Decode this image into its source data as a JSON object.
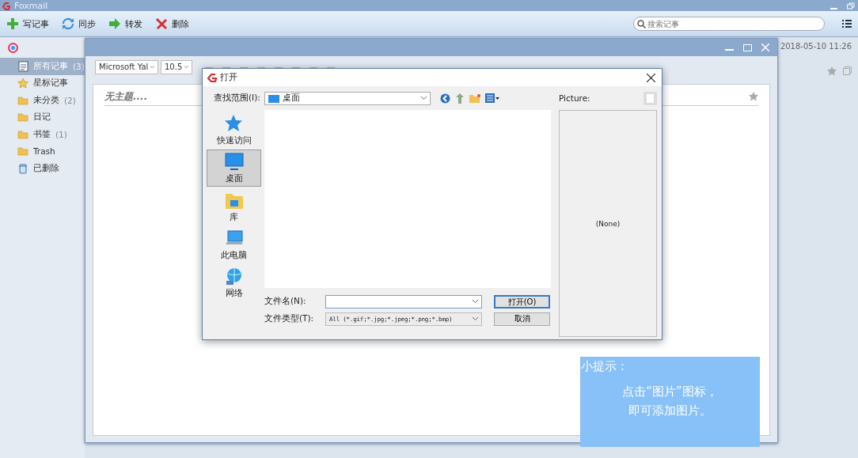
{
  "main_window": {
    "title": "Foxmail",
    "toolbar": [
      {
        "kind": "add",
        "label": "写记事"
      },
      {
        "kind": "sync",
        "label": "同步"
      },
      {
        "kind": "forward",
        "label": "转发"
      },
      {
        "kind": "delete",
        "label": "删除"
      }
    ],
    "search": {
      "placeholder": "搜索记事"
    },
    "sidebar": {
      "items": [
        {
          "kind": "notes",
          "label": "所有记事",
          "count": "(3)",
          "selected": true
        },
        {
          "kind": "star",
          "label": "星标记事",
          "selected": false
        },
        {
          "kind": "folder",
          "label": "未分类",
          "count": "(2)",
          "selected": false
        },
        {
          "kind": "folder",
          "label": "日记",
          "selected": false
        },
        {
          "kind": "folder",
          "label": "书签",
          "count": "(1)",
          "selected": false
        },
        {
          "kind": "folder",
          "label": "Trash",
          "selected": false
        },
        {
          "kind": "trash",
          "label": "已删除",
          "selected": false
        }
      ]
    },
    "timestamp": "2018-05-10 11:26"
  },
  "editor_window": {
    "font": "Microsoft Yal",
    "font_size": "10.5",
    "subject_placeholder": "无主题...."
  },
  "dialog": {
    "title": "打开",
    "look_in_label": "查找范围(I):",
    "look_in": "桌面",
    "places": [
      {
        "kind": "quick",
        "label": "快速访问",
        "selected": false
      },
      {
        "kind": "desktop",
        "label": "桌面",
        "selected": true
      },
      {
        "kind": "library",
        "label": "库",
        "selected": false
      },
      {
        "kind": "pc",
        "label": "此电脑",
        "selected": false
      },
      {
        "kind": "network",
        "label": "网络",
        "selected": false
      }
    ],
    "file_name_label": "文件名(N):",
    "file_type_label": "文件类型(T):",
    "file_type": "All (*.gif;*.jpg;*.jpeg;*.png;*.bmp)",
    "open_button": "打开(O)",
    "cancel_button": "取消",
    "preview_label": "Picture:",
    "preview": "(None)"
  },
  "tip": {
    "title": "小提示：",
    "lines": [
      "点击“图片”图标，",
      "即可添加图片。"
    ]
  }
}
